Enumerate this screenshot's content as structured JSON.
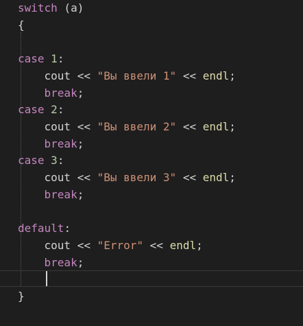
{
  "editor": {
    "lines": [
      {
        "indent": "",
        "tokens": [
          {
            "t": "switch",
            "c": "kw"
          },
          {
            "t": " (",
            "c": "op"
          },
          {
            "t": "a",
            "c": "id"
          },
          {
            "t": ")",
            "c": "op"
          }
        ]
      },
      {
        "indent": "",
        "tokens": [
          {
            "t": "{",
            "c": "op"
          }
        ]
      },
      {
        "indent": "",
        "tokens": []
      },
      {
        "indent": "",
        "tokens": [
          {
            "t": "case",
            "c": "kw"
          },
          {
            "t": " ",
            "c": "op"
          },
          {
            "t": "1",
            "c": "num"
          },
          {
            "t": ":",
            "c": "op"
          }
        ]
      },
      {
        "indent": "    ",
        "tokens": [
          {
            "t": "cout",
            "c": "id"
          },
          {
            "t": " << ",
            "c": "op"
          },
          {
            "t": "\"Вы ввели 1\"",
            "c": "str"
          },
          {
            "t": " << ",
            "c": "op"
          },
          {
            "t": "endl",
            "c": "fn"
          },
          {
            "t": ";",
            "c": "op"
          }
        ]
      },
      {
        "indent": "    ",
        "tokens": [
          {
            "t": "break",
            "c": "kw"
          },
          {
            "t": ";",
            "c": "op"
          }
        ]
      },
      {
        "indent": "",
        "tokens": [
          {
            "t": "case",
            "c": "kw"
          },
          {
            "t": " ",
            "c": "op"
          },
          {
            "t": "2",
            "c": "num"
          },
          {
            "t": ":",
            "c": "op"
          }
        ]
      },
      {
        "indent": "    ",
        "tokens": [
          {
            "t": "cout",
            "c": "id"
          },
          {
            "t": " << ",
            "c": "op"
          },
          {
            "t": "\"Вы ввели 2\"",
            "c": "str"
          },
          {
            "t": " << ",
            "c": "op"
          },
          {
            "t": "endl",
            "c": "fn"
          },
          {
            "t": ";",
            "c": "op"
          }
        ]
      },
      {
        "indent": "    ",
        "tokens": [
          {
            "t": "break",
            "c": "kw"
          },
          {
            "t": ";",
            "c": "op"
          }
        ]
      },
      {
        "indent": "",
        "tokens": [
          {
            "t": "case",
            "c": "kw"
          },
          {
            "t": " ",
            "c": "op"
          },
          {
            "t": "3",
            "c": "num"
          },
          {
            "t": ":",
            "c": "op"
          }
        ]
      },
      {
        "indent": "    ",
        "tokens": [
          {
            "t": "cout",
            "c": "id"
          },
          {
            "t": " << ",
            "c": "op"
          },
          {
            "t": "\"Вы ввели 3\"",
            "c": "str"
          },
          {
            "t": " << ",
            "c": "op"
          },
          {
            "t": "endl",
            "c": "fn"
          },
          {
            "t": ";",
            "c": "op"
          }
        ]
      },
      {
        "indent": "    ",
        "tokens": [
          {
            "t": "break",
            "c": "kw"
          },
          {
            "t": ";",
            "c": "op"
          }
        ]
      },
      {
        "indent": "",
        "tokens": []
      },
      {
        "indent": "",
        "tokens": [
          {
            "t": "default",
            "c": "kw"
          },
          {
            "t": ":",
            "c": "op"
          }
        ]
      },
      {
        "indent": "    ",
        "tokens": [
          {
            "t": "cout",
            "c": "id"
          },
          {
            "t": " << ",
            "c": "op"
          },
          {
            "t": "\"Error\"",
            "c": "str"
          },
          {
            "t": " << ",
            "c": "op"
          },
          {
            "t": "endl",
            "c": "fn"
          },
          {
            "t": ";",
            "c": "op"
          }
        ]
      },
      {
        "indent": "    ",
        "tokens": [
          {
            "t": "break",
            "c": "kw"
          },
          {
            "t": ";",
            "c": "op"
          }
        ]
      },
      {
        "indent": "",
        "tokens": []
      },
      {
        "indent": "",
        "tokens": [
          {
            "t": "}",
            "c": "op"
          }
        ]
      }
    ]
  },
  "colors": {
    "background": "#1e1e1e",
    "keyword": "#c586c0",
    "number": "#b5cea8",
    "string": "#ce9178",
    "function": "#dcdcaa",
    "text": "#d4d4d4"
  }
}
